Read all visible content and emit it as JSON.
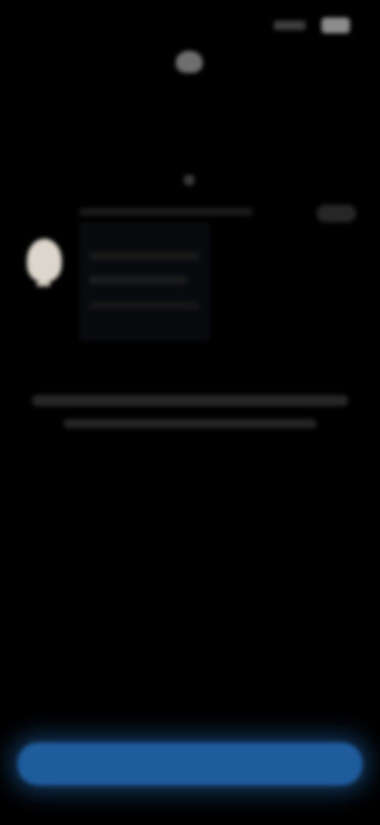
{
  "status_bar": {
    "time": "",
    "icons": [
      "signal-icon",
      "battery-icon"
    ]
  },
  "header": {
    "icon": "notification-icon",
    "title": "",
    "subtitle": ""
  },
  "notification_card": {
    "icon": "bell-icon",
    "link_text": "",
    "footer_left": "",
    "footer_right": ""
  },
  "description": "",
  "footer_link": "",
  "primary_button": {
    "label": ""
  },
  "colors": {
    "background": "#000000",
    "accent": "#1f5c9c"
  }
}
